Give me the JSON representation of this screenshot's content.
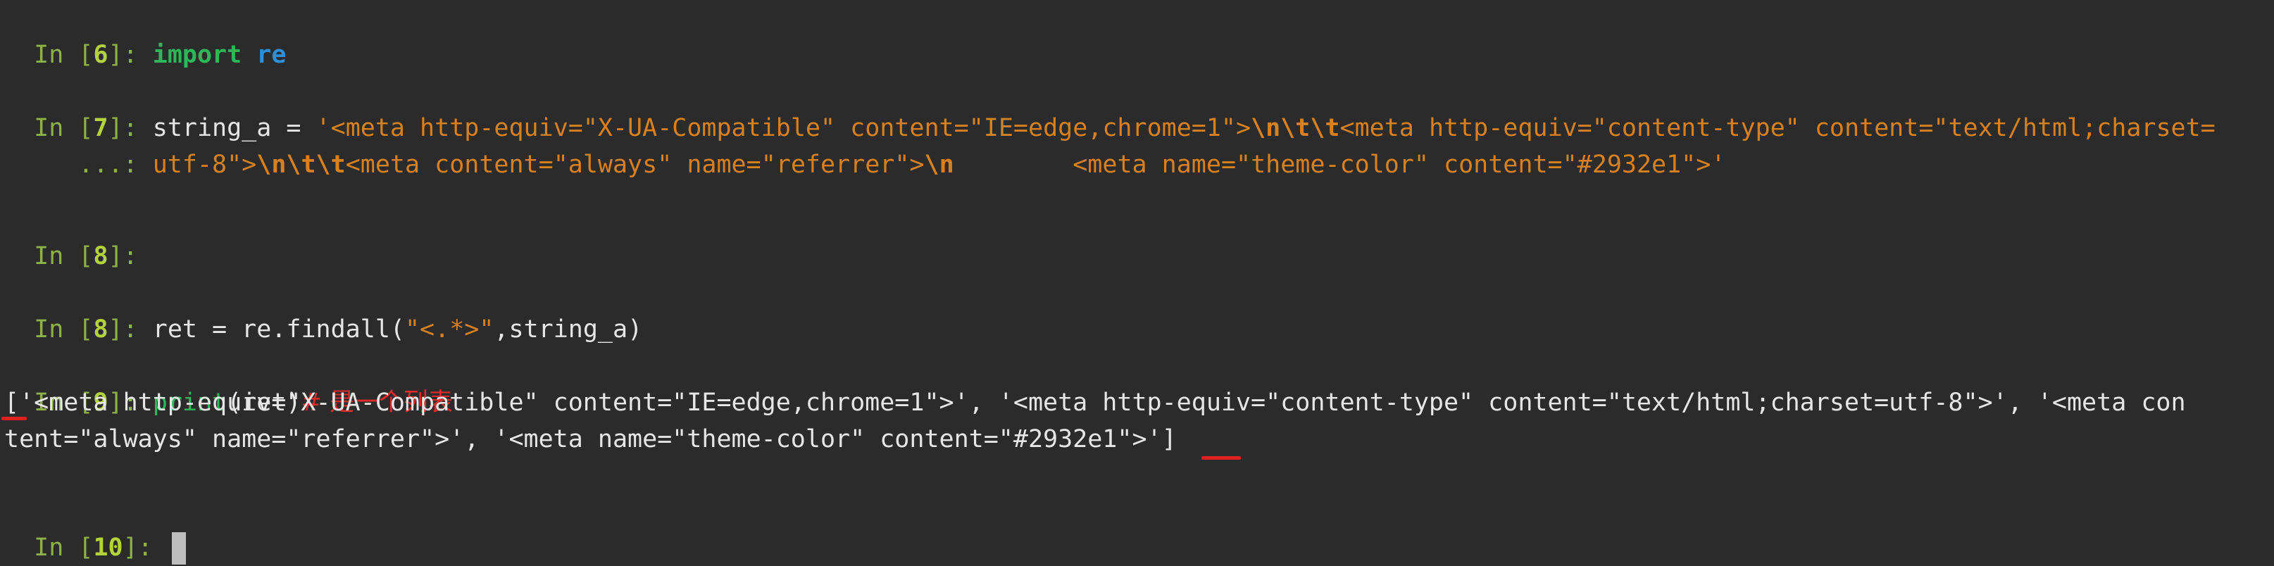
{
  "cells": {
    "c6": {
      "label": "In ",
      "num": "6",
      "suffix": "]: ",
      "code_kw": "import",
      "code_mod": "re"
    },
    "c7": {
      "label": "In ",
      "num": "7",
      "suffix": "]: ",
      "var": "string_a = ",
      "line1_str_a": "'<meta http-equiv=\"X-UA-Compatible\" content=\"IE=edge,chrome=1\">",
      "esc1": "\\n\\t\\t",
      "line1_str_b": "<meta http-equiv=\"content-type\" content=\"text/html;charset=",
      "cont": "   ...: ",
      "line2_str_a": "utf-8\">",
      "esc2": "\\n\\t\\t",
      "line2_str_b": "<meta content=\"always\" name=\"referrer\">",
      "esc3": "\\n",
      "line2_str_c": "        <meta name=\"theme-color\" content=\"#2932e1\">'"
    },
    "c8a": {
      "label": "In ",
      "num": "8",
      "suffix": "]: "
    },
    "c8b": {
      "label": "In ",
      "num": "8",
      "suffix": "]: ",
      "code_a": "ret = re.findall(",
      "code_str": "\"<.*>\"",
      "code_b": ",string_a)"
    },
    "c9": {
      "label": "In ",
      "num": "9",
      "suffix": "]: ",
      "builtin": "print",
      "code": "(ret)",
      "comment": "# 是一个列表"
    },
    "output": {
      "line1": "['<meta http-equiv=\"X-UA-Compatible\" content=\"IE=edge,chrome=1\">', '<meta http-equiv=\"content-type\" content=\"text/html;charset=utf-8\">', '<meta con",
      "line2": "tent=\"always\" name=\"referrer\">', '<meta name=\"theme-color\" content=\"#2932e1\">']"
    },
    "c10": {
      "label": "In ",
      "num": "10",
      "suffix": "]: "
    }
  },
  "colors": {
    "background": "#2b2b2b",
    "prompt": "#8fb14a",
    "prompt_number": "#b4d23a",
    "keyword": "#2fb65a",
    "module": "#2f8fd6",
    "string": "#d7801e",
    "text": "#e6e6e6",
    "annotation": "#e02b2b"
  }
}
